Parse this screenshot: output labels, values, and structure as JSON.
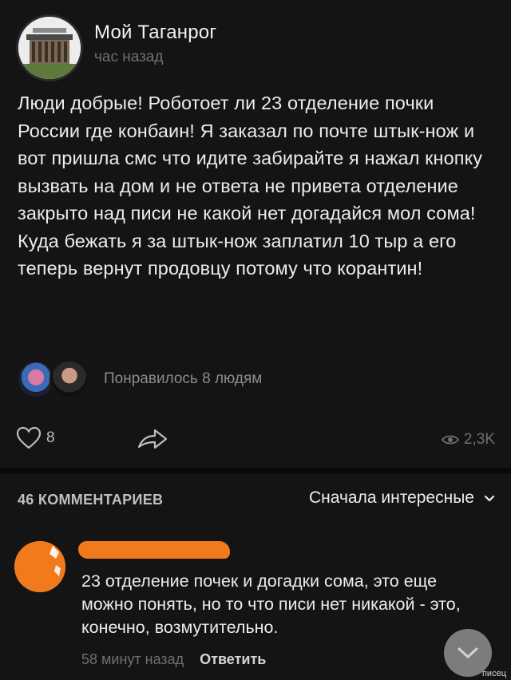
{
  "header": {
    "group_name": "Мой Таганрог",
    "post_time": "час назад"
  },
  "post": {
    "text": "Люди добрые! Роботоет ли 23 отделение почки России где конбаин! Я заказал по почте штык-нож и вот пришла смс что идите забирайте я нажал кнопку вызвать на дом и не ответа не привета отделение закрыто над писи не какой нет догадайся мол сома! Куда бежать я за штык-нож заплатил 10 тыр а его теперь вернут продовцу потому что корантин!"
  },
  "likes": {
    "text": "Понравилось 8 людям"
  },
  "actions": {
    "like_count": "8",
    "views_count": "2,3K"
  },
  "comments": {
    "count_label": "46 КОММЕНТАРИЕВ",
    "sort_label": "Сначала интересные"
  },
  "comment": {
    "text": "23 отделение почек и догадки сома, это еще можно понять, но то что писи нет никакой - это, конечно, возмутительно.",
    "time": "58 минут назад",
    "reply_label": "Ответить"
  },
  "watermark": "писец",
  "colors": {
    "background": "#141414",
    "redaction": "#f07a1c"
  }
}
